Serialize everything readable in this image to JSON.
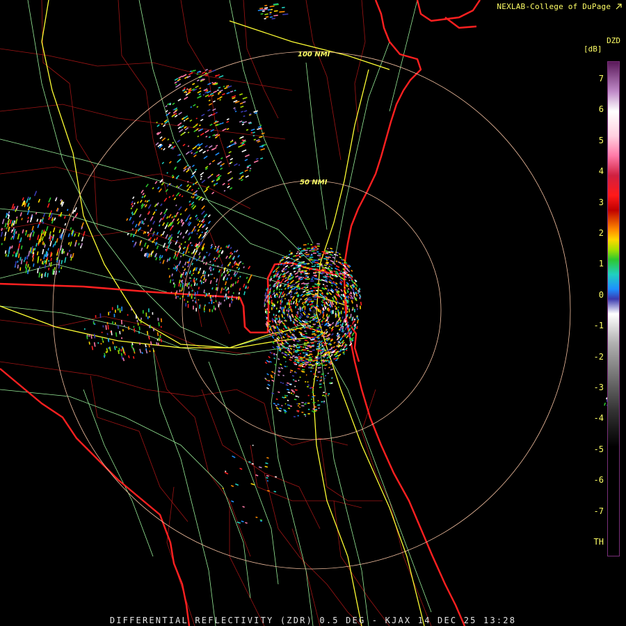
{
  "header": {
    "credit": "NEXLAB-College of DuPage"
  },
  "footer": {
    "caption": "DIFFERENTIAL REFLECTIVITY (ZDR) 0.5 DEG - KJAX 14 DEC 25 13:28"
  },
  "rings": [
    {
      "label": "50 NMI"
    },
    {
      "label": "100 NMI"
    }
  ],
  "colorbar": {
    "product": "DZD",
    "unit": "[dB]",
    "ticks": [
      "7",
      "6",
      "5",
      "4",
      "3",
      "2",
      "1",
      "0",
      "-1",
      "-2",
      "-3",
      "-4",
      "-5",
      "-6",
      "-7",
      "TH"
    ]
  },
  "colors": {
    "state_line": "#ff2020",
    "county_line": "#b01818",
    "highway": "#ffff33",
    "road": "#99ee99",
    "range_ring": "#f4c0a0",
    "text": "#ffff66"
  }
}
